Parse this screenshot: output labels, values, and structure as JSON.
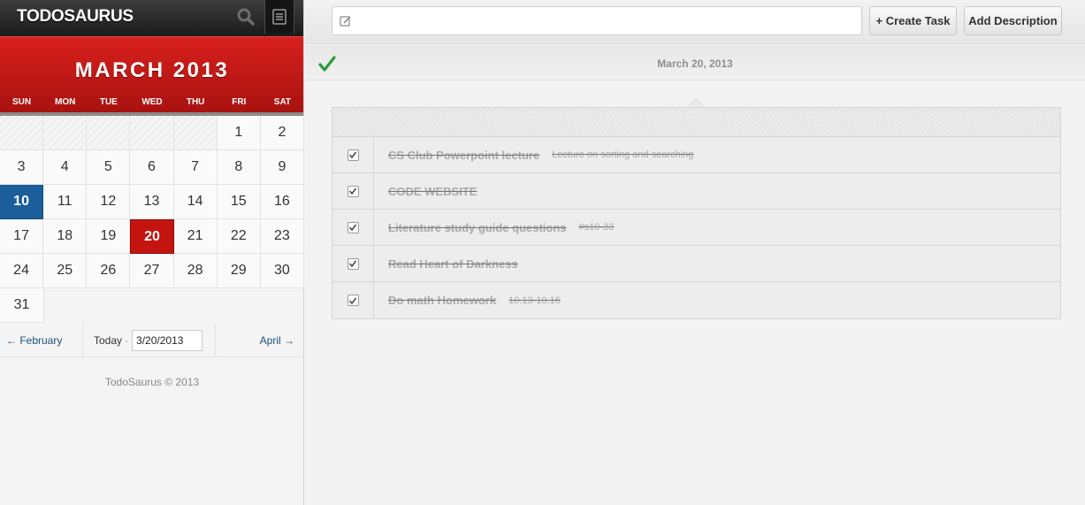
{
  "app": {
    "brand": "TODOSAURUS"
  },
  "calendar": {
    "month_title": "MARCH 2013",
    "weekdays": [
      "SUN",
      "MON",
      "TUE",
      "WED",
      "THU",
      "FRI",
      "SAT"
    ],
    "weeks": [
      [
        "",
        "",
        "",
        "",
        "",
        "1",
        "2"
      ],
      [
        "3",
        "4",
        "5",
        "6",
        "7",
        "8",
        "9"
      ],
      [
        "10",
        "11",
        "12",
        "13",
        "14",
        "15",
        "16"
      ],
      [
        "17",
        "18",
        "19",
        "20",
        "21",
        "22",
        "23"
      ],
      [
        "24",
        "25",
        "26",
        "27",
        "28",
        "29",
        "30"
      ],
      [
        "31"
      ]
    ],
    "today_day": "10",
    "selected_day": "20",
    "prev_label": "← February",
    "today_label": "Today",
    "today_sep": "·",
    "date_value": "3/20/2013",
    "next_label": "April →"
  },
  "footer": {
    "text": "TodoSaurus © 2013"
  },
  "toolbar": {
    "task_placeholder": "",
    "create_label": "+ Create Task",
    "description_label": "Add Description"
  },
  "current_date_label": "March 20, 2013",
  "tasks": [
    {
      "title": "CS Club Powerpoint lecture",
      "description": "Lecture on sorting and searching",
      "done": true
    },
    {
      "title": "CODE WEBSITE",
      "description": "",
      "done": true
    },
    {
      "title": "Literature study guide questions",
      "description": "#s10-33",
      "done": true
    },
    {
      "title": "Read Heart of Darkness",
      "description": "",
      "done": true
    },
    {
      "title": "Do math Homework",
      "description": "10.13-10.16",
      "done": true
    }
  ],
  "colors": {
    "brand_red": "#c4140f",
    "today_blue": "#1b5e9b",
    "check_green": "#2c9a3a"
  },
  "icons": {
    "search": "search-icon",
    "list": "list-icon",
    "pencil": "pencil-icon",
    "check": "checkmark-icon"
  }
}
